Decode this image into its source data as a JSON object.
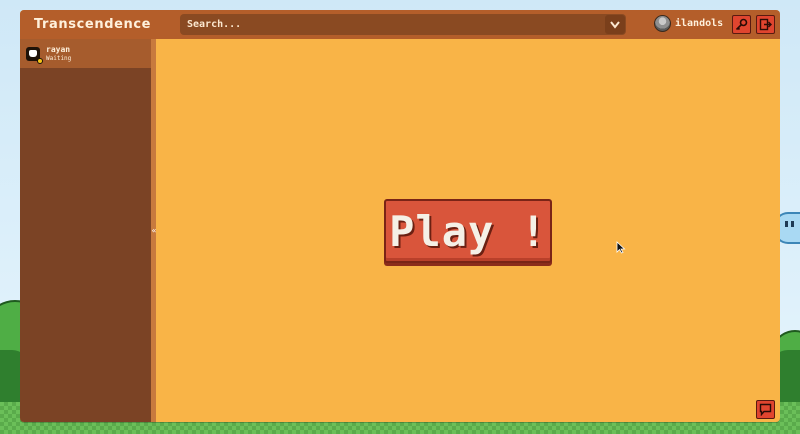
{
  "app": {
    "title": "Transcendence"
  },
  "search": {
    "placeholder": "Search..."
  },
  "user": {
    "name": "ilandols"
  },
  "icons": {
    "settings": "key-icon",
    "logout": "logout-icon",
    "chat": "chat-bubble-icon",
    "chevron": "chevron-down-icon"
  },
  "sidebar": {
    "friends": [
      {
        "name": "rayan",
        "status": "Waiting",
        "status_color": "#f5c518"
      }
    ],
    "collapse_label": "«"
  },
  "main": {
    "play_label": "Play !"
  },
  "colors": {
    "accent": "#d9553b",
    "topbar": "#b45e2a",
    "main_bg": "#f9b447",
    "sidebar_bg": "#7b4325"
  }
}
